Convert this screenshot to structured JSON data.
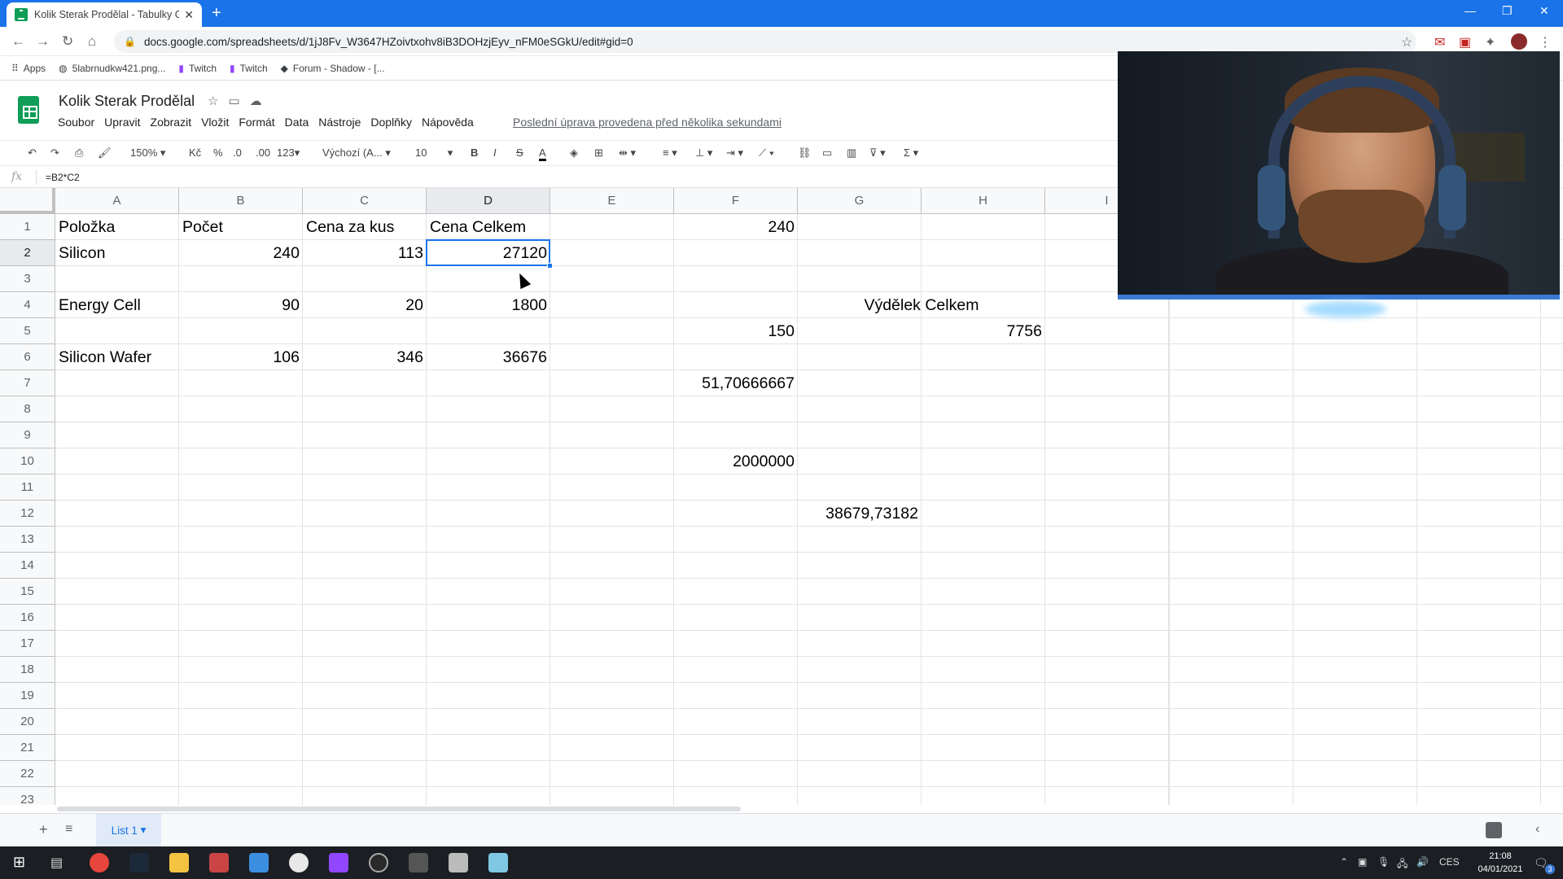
{
  "browser": {
    "tab_title": "Kolik Sterak Prodělal - Tabulky G",
    "url": "docs.google.com/spreadsheets/d/1jJ8Fv_W3647HZoivtxohv8iB3DOHzjEyv_nFM0eSGkU/edit#gid=0",
    "bookmarks": [
      "Apps",
      "5labrnudkw421.png...",
      "Twitch",
      "Twitch",
      "Forum - Shadow - [..."
    ]
  },
  "doc": {
    "title": "Kolik Sterak Prodělal",
    "menu": [
      "Soubor",
      "Upravit",
      "Zobrazit",
      "Vložit",
      "Formát",
      "Data",
      "Nástroje",
      "Doplňky",
      "Nápověda"
    ],
    "last_edit": "Poslední úprava provedena před několika sekundami"
  },
  "toolbar": {
    "zoom": "150%",
    "currency": "Kč",
    "percent": "%",
    "dec_less": ".0",
    "dec_more": ".00",
    "format_more": "123",
    "font": "Výchozí (A...",
    "font_size": "10",
    "bold": "B",
    "italic": "I",
    "strike": "S",
    "text_color": "A",
    "sum": "Σ"
  },
  "formula": {
    "fx": "fx",
    "text": "=B2*C2"
  },
  "columns": [
    "A",
    "B",
    "C",
    "D",
    "E",
    "F",
    "G",
    "H",
    "I"
  ],
  "rows": [
    "1",
    "2",
    "3",
    "4",
    "5",
    "6",
    "7",
    "8",
    "9",
    "10",
    "11",
    "12",
    "13",
    "14",
    "15",
    "16",
    "17",
    "18",
    "19",
    "20",
    "21",
    "22",
    "23"
  ],
  "cells": {
    "A1": "Položka",
    "B1": "Počet",
    "C1": "Cena za kus",
    "D1": "Cena Celkem",
    "F1": "240",
    "A2": "Silicon",
    "B2": "240",
    "C2": "113",
    "D2": "27120",
    "A4": "Energy Cell",
    "B4": "90",
    "C4": "20",
    "D4": "1800",
    "G4": "Výdělek Celkem",
    "F5": "150",
    "H5": "7756",
    "A6": "Silicon Wafer",
    "B6": "106",
    "C6": "346",
    "D6": "36676",
    "F7": "51,70666667",
    "F10": "2000000",
    "G12": "38679,73182"
  },
  "sheet": {
    "tab": "List 1"
  },
  "taskbar": {
    "lang": "CES",
    "time": "21:08",
    "date": "04/01/2021",
    "badge": "3"
  }
}
